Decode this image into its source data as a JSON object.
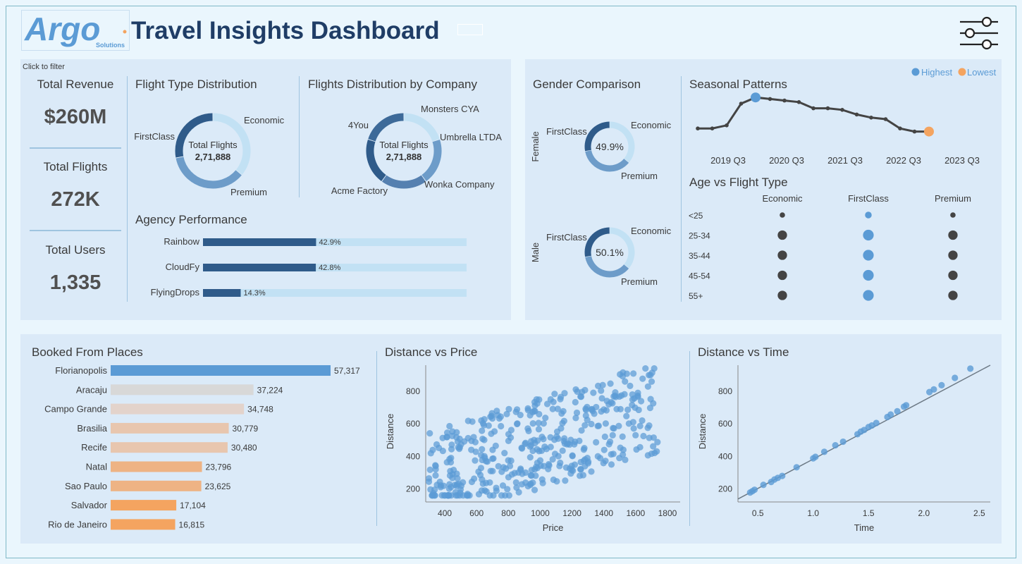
{
  "colors": {
    "dark_blue": "#2f5b8a",
    "mid_blue": "#6d9cc9",
    "light_blue": "#c2e1f4",
    "highlight_blue": "#5b9bd5",
    "orange": "#f4a460",
    "panel": "#dbeaf8"
  },
  "header": {
    "logo_main": "Argo",
    "logo_sub": "Solutions",
    "title": "Travel Insights Dashboard",
    "settings_icon": "sliders-icon"
  },
  "kpi": {
    "hint": "Click to filter",
    "revenue_label": "Total Revenue",
    "revenue_value": "$260M",
    "flights_label": "Total Flights",
    "flights_value": "272K",
    "users_label": "Total Users",
    "users_value": "1,335"
  },
  "chart_data": [
    {
      "id": "flight_type",
      "type": "pie",
      "title": "Flight Type Distribution",
      "center_label": "Total Flights",
      "center_value": "2,71,888",
      "labels": [
        "Economic",
        "Premium",
        "FirstClass"
      ],
      "values": [
        0.36,
        0.36,
        0.28
      ]
    },
    {
      "id": "company",
      "type": "pie",
      "title": "Flights Distribution by Company",
      "center_label": "Total Flights",
      "center_value": "2,71,888",
      "labels": [
        "Monsters CYA",
        "Umbrella LTDA",
        "Wonka Company",
        "Acme Factory",
        "4You"
      ],
      "values": [
        0.2,
        0.2,
        0.2,
        0.2,
        0.2
      ]
    },
    {
      "id": "agency",
      "type": "bar",
      "title": "Agency Performance",
      "categories": [
        "Rainbow",
        "CloudFy",
        "FlyingDrops"
      ],
      "values": [
        42.9,
        42.8,
        14.3
      ],
      "value_labels": [
        "42.9%",
        "42.8%",
        "14.3%"
      ],
      "ylim": [
        0,
        100
      ]
    },
    {
      "id": "gender",
      "type": "pie",
      "title": "Gender Comparison",
      "groups": [
        {
          "name": "Female",
          "center": "49.9%",
          "labels": [
            "Economic",
            "Premium",
            "FirstClass"
          ],
          "values": [
            0.36,
            0.36,
            0.28
          ]
        },
        {
          "name": "Male",
          "center": "50.1%",
          "labels": [
            "Economic",
            "Premium",
            "FirstClass"
          ],
          "values": [
            0.36,
            0.36,
            0.28
          ]
        }
      ]
    },
    {
      "id": "seasonal",
      "type": "line",
      "title": "Seasonal Patterns",
      "legend": [
        "Highest",
        "Lowest"
      ],
      "tick_labels": [
        "2019 Q3",
        "2020 Q3",
        "2021 Q3",
        "2022 Q3",
        "2023 Q3"
      ],
      "values": [
        14,
        14,
        16,
        30,
        34,
        33,
        32,
        31,
        27,
        27,
        26,
        23,
        21,
        20,
        14,
        12,
        12
      ],
      "highest_index": 4,
      "lowest_index": 16
    },
    {
      "id": "age_type",
      "type": "scatter",
      "title": "Age vs Flight Type",
      "x_categories": [
        "Economic",
        "FirstClass",
        "Premium"
      ],
      "y_categories": [
        "<25",
        "25-34",
        "35-44",
        "45-54",
        "55+"
      ],
      "sizes": [
        [
          4,
          5,
          4
        ],
        [
          7,
          8,
          7
        ],
        [
          7,
          8,
          7
        ],
        [
          7,
          8,
          7
        ],
        [
          7,
          8,
          7
        ]
      ]
    },
    {
      "id": "places",
      "type": "bar",
      "title": "Booked From Places",
      "categories": [
        "Florianopolis",
        "Aracaju",
        "Campo Grande",
        "Brasilia",
        "Recife",
        "Natal",
        "Sao Paulo",
        "Salvador",
        "Rio de Janeiro"
      ],
      "values": [
        57317,
        37224,
        34748,
        30779,
        30480,
        23796,
        23625,
        17104,
        16815
      ],
      "value_labels": [
        "57,317",
        "37,224",
        "34,748",
        "30,779",
        "30,480",
        "23,796",
        "23,625",
        "17,104",
        "16,815"
      ],
      "bar_colors": [
        "#5b9bd5",
        "#d8d8d8",
        "#e3d3cb",
        "#e8c6ae",
        "#e8c6ae",
        "#eeb384",
        "#eeb384",
        "#f4a460",
        "#f4a460"
      ]
    },
    {
      "id": "dist_price",
      "type": "scatter",
      "title": "Distance vs Price",
      "xlabel": "Price",
      "ylabel": "Distance",
      "xlim": [
        280,
        1880
      ],
      "ylim": [
        120,
        960
      ],
      "x_ticks": [
        "400",
        "600",
        "800",
        "1000",
        "1200",
        "1400",
        "1600",
        "1800"
      ],
      "y_ticks": [
        "200",
        "400",
        "600",
        "800"
      ]
    },
    {
      "id": "dist_time",
      "type": "scatter",
      "title": "Distance vs Time",
      "xlabel": "Time",
      "ylabel": "Distance",
      "xlim": [
        0.32,
        2.6
      ],
      "ylim": [
        120,
        960
      ],
      "x_ticks": [
        "0.5",
        "1.0",
        "1.5",
        "2.0",
        "2.5"
      ],
      "y_ticks": [
        "200",
        "400",
        "600",
        "800"
      ],
      "x": [
        0.43,
        0.45,
        0.47,
        0.55,
        0.62,
        0.65,
        0.68,
        0.72,
        0.85,
        1.0,
        1.02,
        1.1,
        1.2,
        1.27,
        1.4,
        1.43,
        1.46,
        1.5,
        1.53,
        1.57,
        1.67,
        1.7,
        1.76,
        1.82,
        1.84,
        2.05,
        2.09,
        2.16,
        2.28,
        2.42
      ],
      "y": [
        178,
        186,
        195,
        225,
        243,
        258,
        268,
        280,
        333,
        388,
        397,
        428,
        468,
        490,
        536,
        552,
        562,
        580,
        590,
        605,
        642,
        657,
        677,
        705,
        714,
        795,
        811,
        837,
        882,
        939
      ]
    }
  ]
}
